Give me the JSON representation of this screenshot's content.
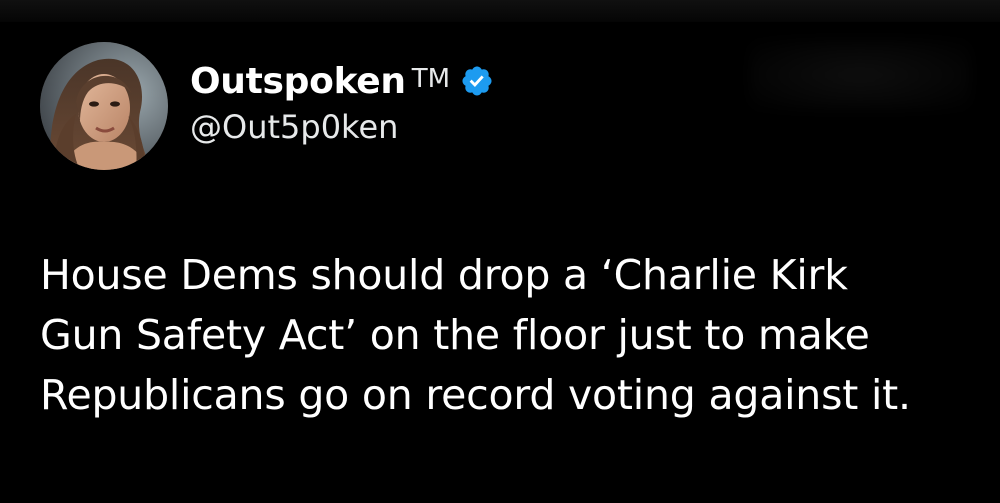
{
  "tweet": {
    "author": {
      "display_name": "Outspoken",
      "tm_mark": "TM",
      "handle": "@Out5p0ken",
      "verified_icon": "verified-badge-icon",
      "avatar_icon": "avatar"
    },
    "body_lines": [
      "House Dems should drop a ‘Charlie Kirk",
      "Gun Safety Act’ on the floor just to make",
      "Republicans go on record voting against it."
    ]
  },
  "colors": {
    "background": "#000000",
    "text": "#ffffff",
    "verified": "#1d9bf0"
  }
}
